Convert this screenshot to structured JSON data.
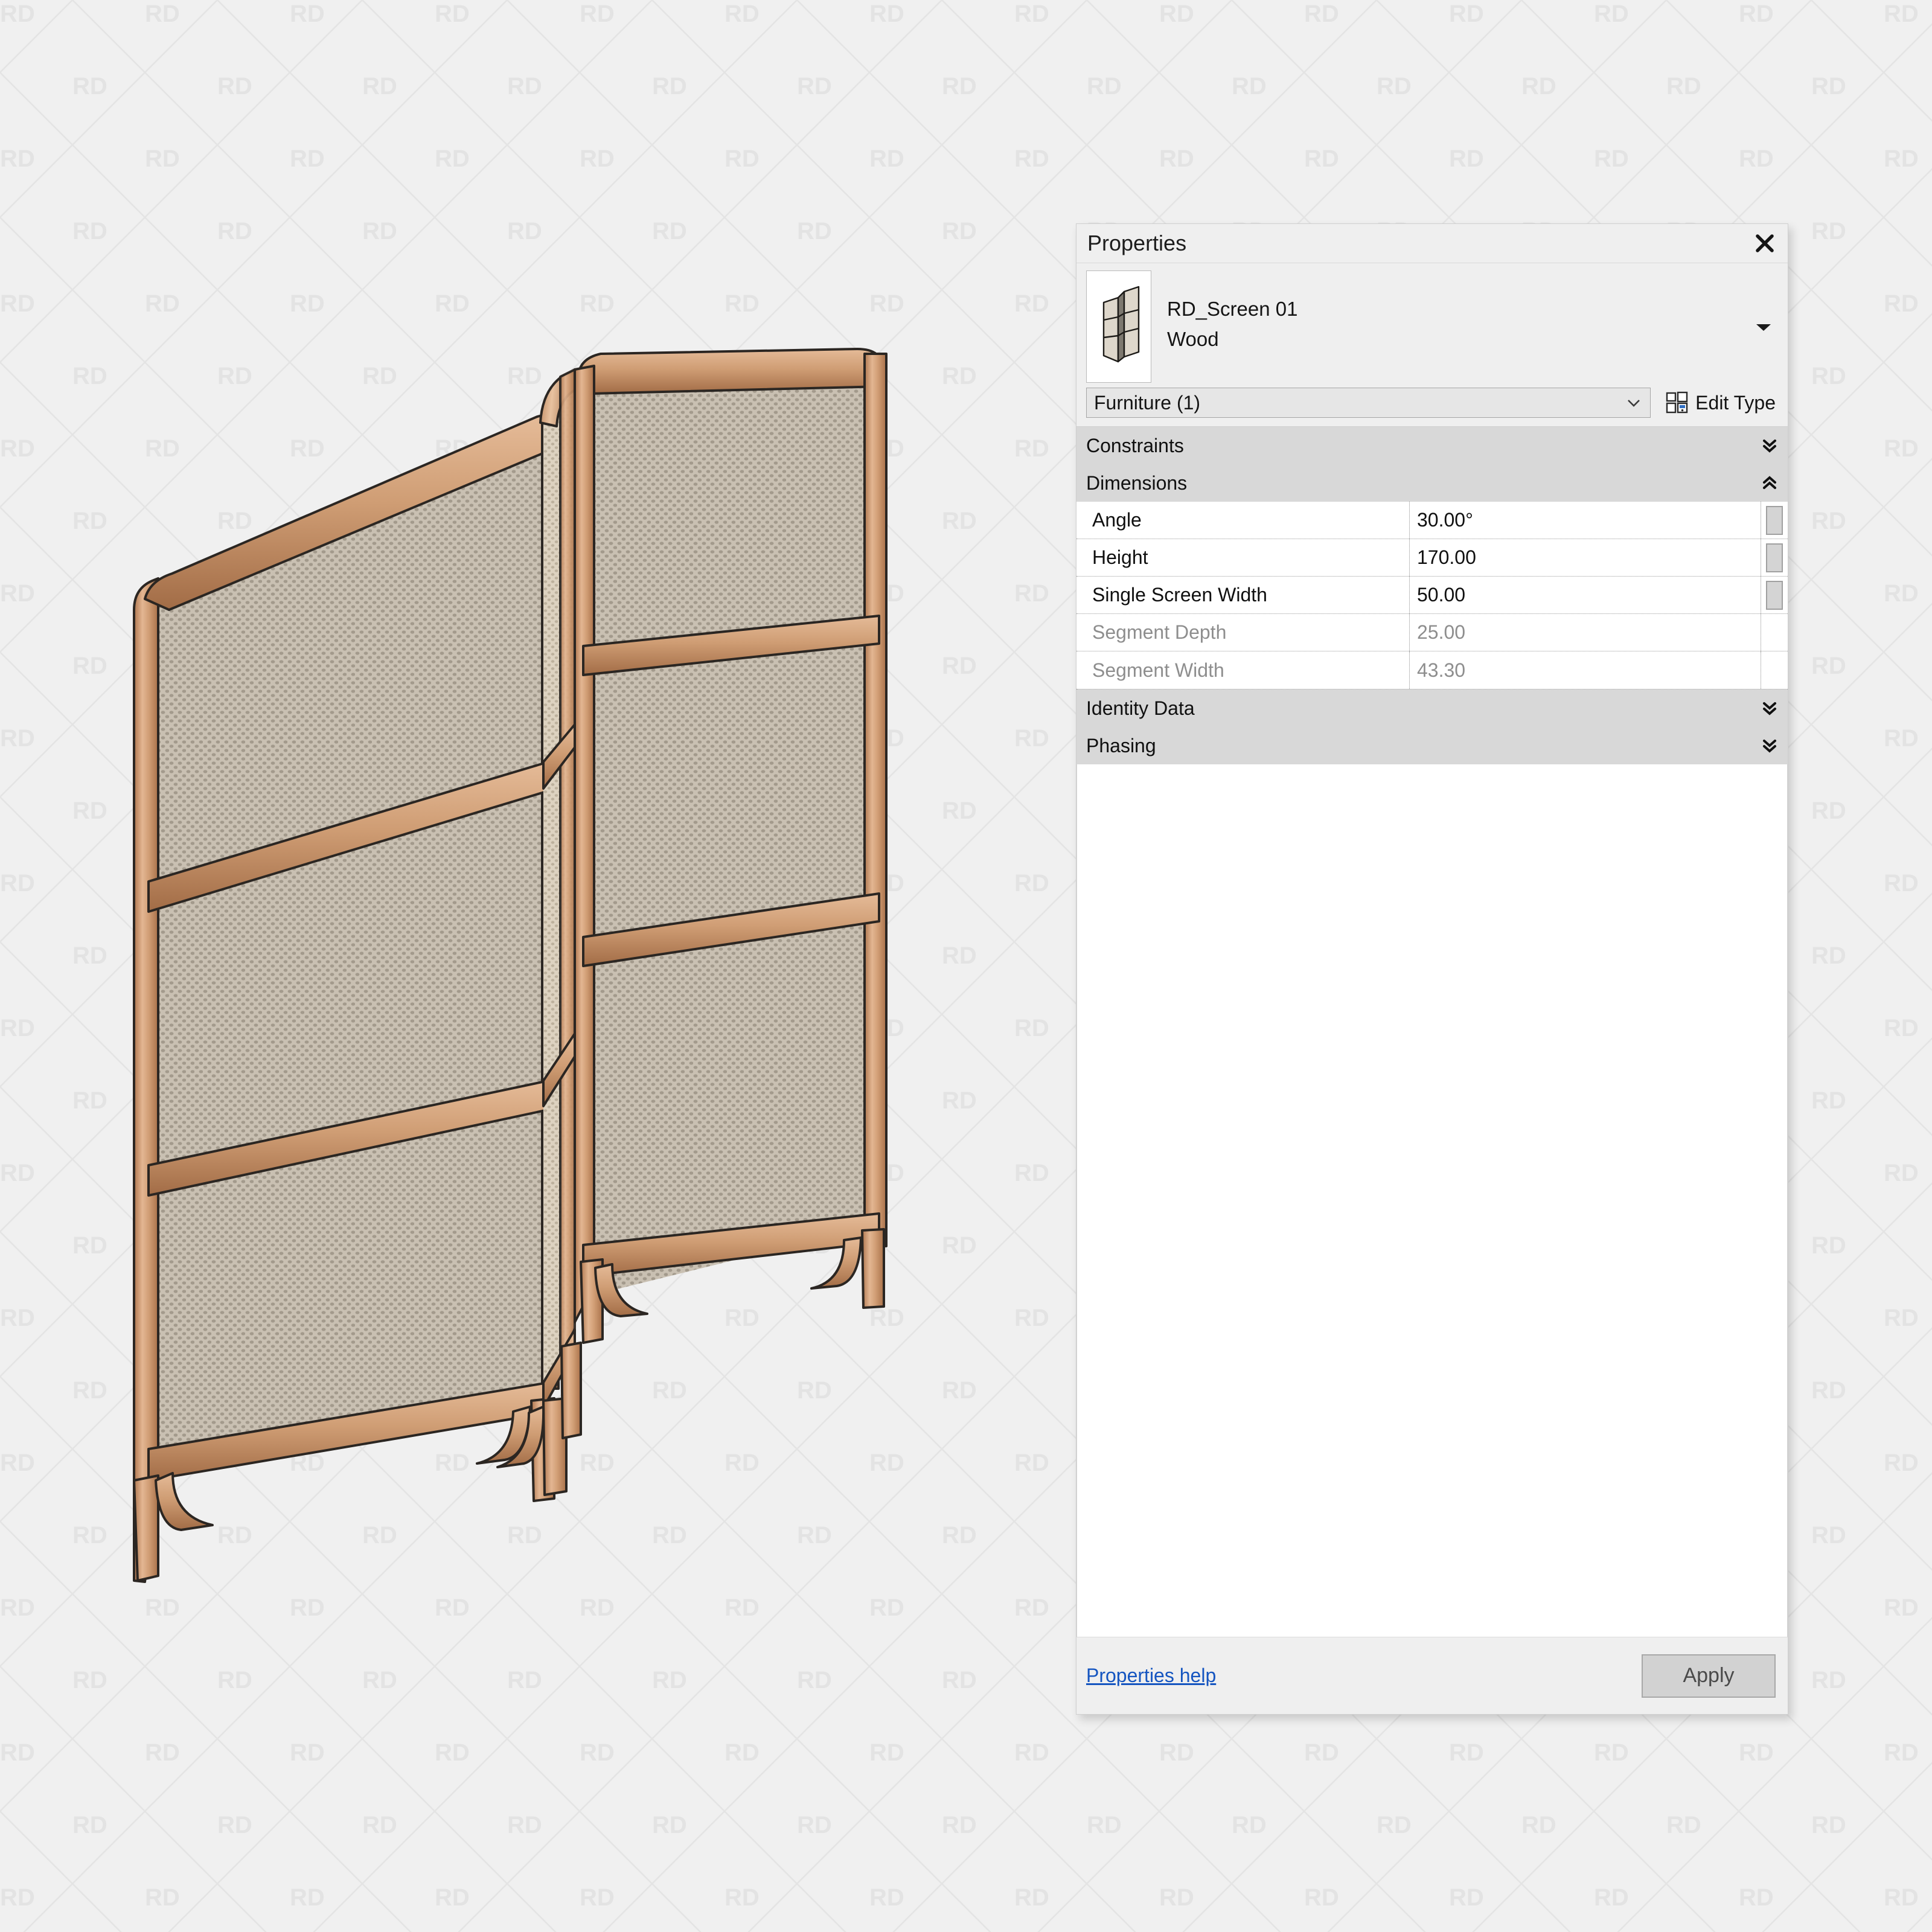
{
  "background": {
    "color": "#f0f0f0",
    "watermark_text": "RD",
    "watermark_color": "#e2e2e2"
  },
  "illustration": {
    "name": "rd-screen-01-wood-3d-view",
    "description": "Three panel folding room divider screen, wood frame with mesh panels",
    "frame_color": "#c89670",
    "frame_highlight": "#e6bb94",
    "frame_shadow": "#9c6a47",
    "mesh_color": "#c3baac",
    "mesh_light": "#d8cdbd",
    "outline_color": "#2c2824",
    "panel_count": 3
  },
  "panel": {
    "title": "Properties",
    "close_label": "✕",
    "type_family": "RD_Screen 01",
    "type_name": "Wood",
    "category": "Furniture (1)",
    "edit_type_label": "Edit Type",
    "groups": [
      {
        "label": "Constraints",
        "state": "collapsed",
        "rows": []
      },
      {
        "label": "Dimensions",
        "state": "expanded",
        "rows": [
          {
            "name": "Angle",
            "value": "30.00°",
            "readonly": false,
            "has_button": true
          },
          {
            "name": "Height",
            "value": "170.00",
            "readonly": false,
            "has_button": true
          },
          {
            "name": "Single Screen Width",
            "value": "50.00",
            "readonly": false,
            "has_button": true
          },
          {
            "name": "Segment Depth",
            "value": "25.00",
            "readonly": true,
            "has_button": false
          },
          {
            "name": "Segment Width",
            "value": "43.30",
            "readonly": true,
            "has_button": false
          }
        ]
      },
      {
        "label": "Identity Data",
        "state": "collapsed",
        "rows": []
      },
      {
        "label": "Phasing",
        "state": "collapsed",
        "rows": []
      }
    ],
    "footer": {
      "help_label": "Properties help",
      "apply_label": "Apply"
    }
  }
}
